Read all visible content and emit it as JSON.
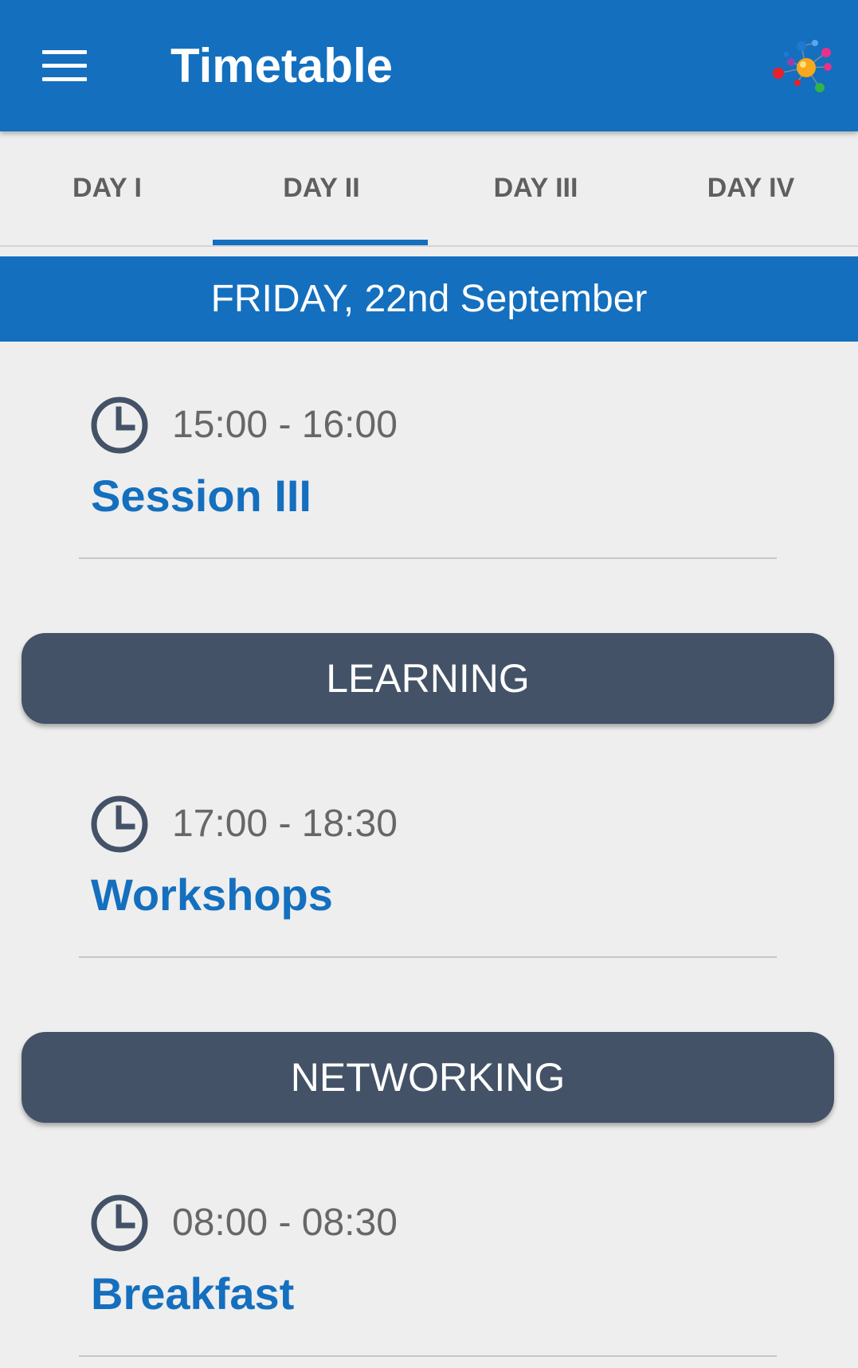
{
  "app_bar": {
    "title": "Timetable",
    "menu_icon": "hamburger-menu-icon",
    "logo_icon": "molecule-logo-icon",
    "color": "#146fbe"
  },
  "tabs": [
    {
      "label": "DAY I",
      "selected": false
    },
    {
      "label": "DAY II",
      "selected": true
    },
    {
      "label": "DAY III",
      "selected": false
    },
    {
      "label": "DAY IV",
      "selected": false
    }
  ],
  "date_banner": "FRIDAY, 22nd September",
  "schedule": {
    "events": [
      {
        "time": "15:00 - 16:00",
        "title": "Session III"
      },
      {
        "time": "17:00 - 18:30",
        "title": "Workshops"
      },
      {
        "time": "08:00 - 08:30",
        "title": "Breakfast"
      }
    ],
    "categories": [
      "LEARNING",
      "NETWORKING"
    ]
  },
  "colors": {
    "primary": "#146fbe",
    "category_bg": "#435266",
    "background": "#eeeeee",
    "time_text": "#676767"
  }
}
